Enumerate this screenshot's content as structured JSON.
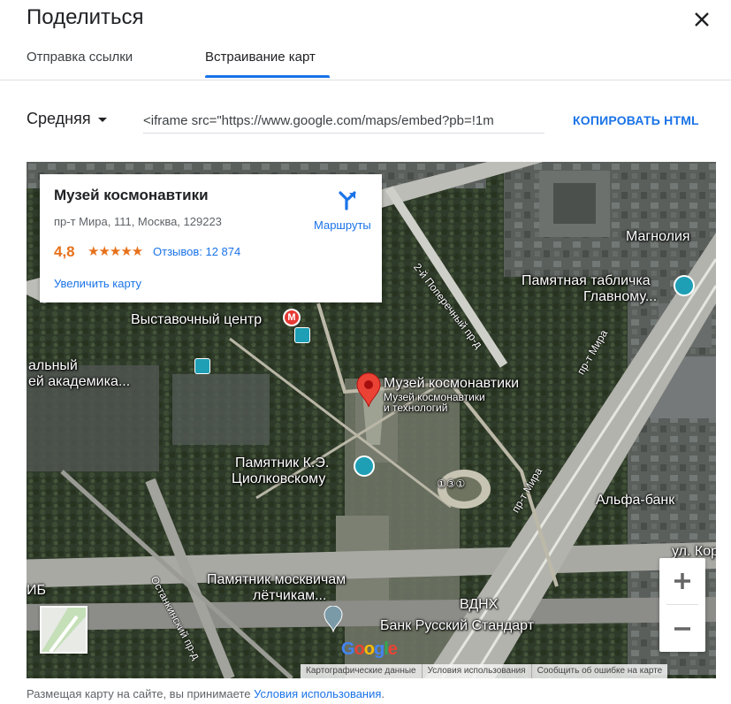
{
  "dialog": {
    "title": "Поделиться",
    "tabs": [
      {
        "label": "Отправка ссылки",
        "active": false
      },
      {
        "label": "Встраивание карт",
        "active": true
      }
    ]
  },
  "embed": {
    "size_label": "Средняя",
    "iframe_code": "<iframe src=\"https://www.google.com/maps/embed?pb=!1m",
    "copy_label": "КОПИРОВАТЬ HTML"
  },
  "place_card": {
    "name": "Музей космонавтики",
    "address": "пр-т Мира, 111, Москва, 129223",
    "rating": "4,8",
    "stars": "★★★★★",
    "reviews": "Отзывов: 12 874",
    "enlarge": "Увеличить карту",
    "routes": "Маршруты"
  },
  "map": {
    "labels": {
      "vystavochny": "Выставочный центр",
      "museum_title": "Музей космонавтики",
      "museum_sub1": "Музей космонавтики",
      "museum_sub2": "и технологий",
      "tsiolkovsky1": "Памятник К.Э.",
      "tsiolkovsky2": "Циолковскому",
      "moskvicham1": "Памятник москвичам",
      "moskvicham2": "лётчикам...",
      "magnoliya": "Магнолия",
      "tablichka1": "Памятная табличка",
      "tablichka2": "Главному...",
      "alfa": "Альфа-банк",
      "vdnh": "ВДНХ",
      "bank_rs": "Банк Русский Стандарт",
      "left1": "альный",
      "left2": "ей академика...",
      "ib": "ИБ",
      "ul_kor": "ул. Кор",
      "metro_badge": "①③①"
    },
    "roads": {
      "poperech": "2-й Поперечный пр-д",
      "mira_upper": "пр-т Мира",
      "mira_lower": "пр-т Мира",
      "ostankino": "Останкинский пр-д"
    },
    "attribution": {
      "data": "Картографические данные",
      "terms": "Условия использования",
      "report": "Сообщить об ошибке на карте"
    },
    "logo": "Google",
    "colors": {
      "accent": "#1a73e8",
      "rating": "#e7711b",
      "pin": "#ea4335",
      "metro": "#e53935",
      "poi_teal": "#1e9fb5"
    }
  },
  "footer": {
    "text": "Размещая карту на сайте, вы принимаете ",
    "link": "Условия использования",
    "end": "."
  }
}
